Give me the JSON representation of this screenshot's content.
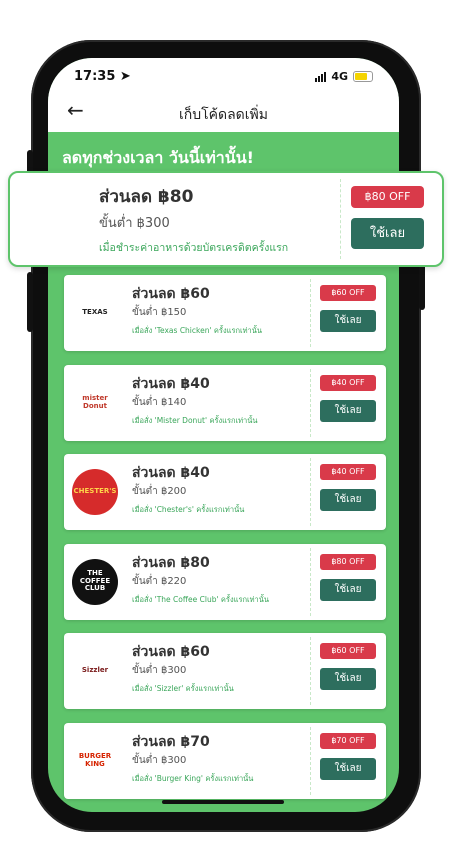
{
  "status": {
    "time": "17:35",
    "network": "4G"
  },
  "header": {
    "title": "เก็บโค้ดลดเพิ่ม"
  },
  "banner": {
    "text": "ลดทุกช่วงเวลา วันนี้เท่านั้น!"
  },
  "featured": {
    "title": "ส่วนลด ฿80",
    "min": "ขั้นต่ำ ฿300",
    "cond": "เมื่อชำระค่าอาหารด้วยบัตรเครดิตครั้งแรก",
    "off": "฿80 OFF",
    "use": "ใช้เลย"
  },
  "coupons": [
    {
      "brand": "TEXAS",
      "title": "ส่วนลด ฿60",
      "min": "ขั้นต่ำ ฿150",
      "cond": "เมื่อสั่ง 'Texas Chicken' ครั้งแรกเท่านั้น",
      "off": "฿60 OFF",
      "use": "ใช้เลย",
      "logo_bg": "#ffffff",
      "logo_fg": "#222222"
    },
    {
      "brand": "mister Donut",
      "title": "ส่วนลด ฿40",
      "min": "ขั้นต่ำ ฿140",
      "cond": "เมื่อสั่ง 'Mister Donut' ครั้งแรกเท่านั้น",
      "off": "฿40 OFF",
      "use": "ใช้เลย",
      "logo_bg": "#ffffff",
      "logo_fg": "#c0392b"
    },
    {
      "brand": "CHESTER'S",
      "title": "ส่วนลด ฿40",
      "min": "ขั้นต่ำ ฿200",
      "cond": "เมื่อสั่ง 'Chester's' ครั้งแรกเท่านั้น",
      "off": "฿40 OFF",
      "use": "ใช้เลย",
      "logo_bg": "#d62b2b",
      "logo_fg": "#ffd54a"
    },
    {
      "brand": "THE COFFEE CLUB",
      "title": "ส่วนลด ฿80",
      "min": "ขั้นต่ำ ฿220",
      "cond": "เมื่อสั่ง 'The Coffee Club' ครั้งแรกเท่านั้น",
      "off": "฿80 OFF",
      "use": "ใช้เลย",
      "logo_bg": "#111111",
      "logo_fg": "#ffffff"
    },
    {
      "brand": "Sizzler",
      "title": "ส่วนลด ฿60",
      "min": "ขั้นต่ำ ฿300",
      "cond": "เมื่อสั่ง 'Sizzler' ครั้งแรกเท่านั้น",
      "off": "฿60 OFF",
      "use": "ใช้เลย",
      "logo_bg": "#ffffff",
      "logo_fg": "#7a1a1a"
    },
    {
      "brand": "BURGER KING",
      "title": "ส่วนลด ฿70",
      "min": "ขั้นต่ำ ฿300",
      "cond": "เมื่อสั่ง 'Burger King' ครั้งแรกเท่านั้น",
      "off": "฿70 OFF",
      "use": "ใช้เลย",
      "logo_bg": "#ffffff",
      "logo_fg": "#d62300"
    }
  ]
}
